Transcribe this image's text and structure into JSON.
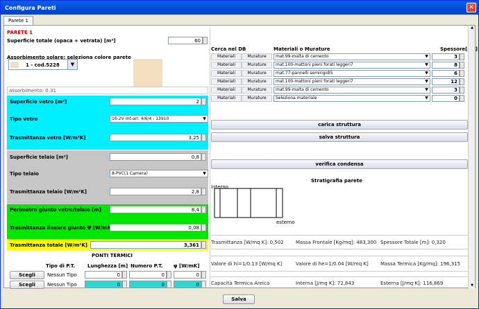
{
  "window": {
    "title": "Configura Pareti"
  },
  "tabs": [
    "Parete 1"
  ],
  "left": {
    "parete_title": "PARETE 1",
    "sup_label": "Superficie totale (opaca + vetrata) [m²]",
    "sup_value": "60",
    "assorb_label": "Assorbimento solare: seleziona colore parete",
    "color_value": "1 - cod.5228",
    "assorb_value": "assorbimento: 0.31",
    "sup_vetro_label": "Superficie vetro [m²]",
    "sup_vetro_value": "2",
    "tipo_vetro_label": "Tipo vetro",
    "tipo_vetro_value": "16-2V mt-arr. 4/6/4 - 13910",
    "trasm_vetro_label": "Trasmittanza vetro [W/m²K]",
    "trasm_vetro_value": "3,25",
    "sup_telaio_label": "Superficie telaio [m²]",
    "sup_telaio_value": "0,8",
    "tipo_telaio_label": "Tipo telaio",
    "tipo_telaio_value": "8-PVC(1 Camera)",
    "trasm_telaio_label": "Trasmittanza telaio [W/m²K]",
    "trasm_telaio_value": "2,8",
    "perim_label": "Perimetro giunto vetro/telaio [m]",
    "perim_value": "8,4",
    "trasm_lin_label": "Trasmittanza lineare giunto Ψ [W/mK]",
    "trasm_lin_value": "0,08",
    "trasm_tot_label": "Trasmittanza totale [W/m²K]",
    "trasm_tot_value": "3,361",
    "ponti_title": "PONTI TERMICI",
    "ponti_headers": [
      "Tipo di P.T.",
      "Lunghezza [m]",
      "Numero P.T.",
      "ψ [W/mK]"
    ],
    "ponti_rows": [
      {
        "btn": "Scegli",
        "tipo": "Nessun Tipo",
        "l": "0",
        "n": "0",
        "p": "0"
      },
      {
        "btn": "Scegli",
        "tipo": "Nessun Tipo",
        "l": "0",
        "n": "0",
        "p": "0"
      }
    ]
  },
  "right": {
    "headers": {
      "db": "Cerca nel DB",
      "mat": "Materiali o Murature",
      "sp": "Spessore[cm]"
    },
    "rows": [
      {
        "b1": "Materiali",
        "b2": "Murature",
        "mat": "mat.99-malta di cemento",
        "sp": "3"
      },
      {
        "b1": "Materiali",
        "b2": "Murature",
        "mat": "mat.100-mattoni pieni forati leggeri7",
        "sp": "8"
      },
      {
        "b1": "Materiali",
        "b2": "Murature",
        "mat": "mat.77-pannelli semirigidi5",
        "sp": "6"
      },
      {
        "b1": "Materiali",
        "b2": "Murature",
        "mat": "mat.100-mattoni pieni forati leggeri7",
        "sp": "12"
      },
      {
        "b1": "Materiali",
        "b2": "Murature",
        "mat": "mat.99-malta di cemento",
        "sp": "3"
      },
      {
        "b1": "Materiali",
        "b2": "Murature",
        "mat": "Seleziona materiale",
        "sp": "0"
      }
    ],
    "carica": "carica struttura",
    "salva": "salva struttura",
    "verifica": "verifica condensa",
    "strat_title": "Stratigrafia parete",
    "interno": "interno",
    "esterno": "esterno",
    "trasm": "Trasmittanza [W/mq K]:  0,502",
    "massa_front": "Massa Frontale [Kg/mq]:  483,300",
    "spess_tot": "Spessore Totale [m]:  0,320",
    "valore1": "Valore di hi=1/0.13 [W/mq K]",
    "valore2": "Valore di he=1/0.04 [W/mq K]",
    "massa_term": "Massa Termica [Kg/mq]:  196,315",
    "capacita": "Capacità Termica Areica",
    "interna": "Interna [J/mq K]:  72,843",
    "esterna": "Esterna [J/mq K]:  116,869"
  },
  "footer": {
    "salva": "Salva"
  }
}
